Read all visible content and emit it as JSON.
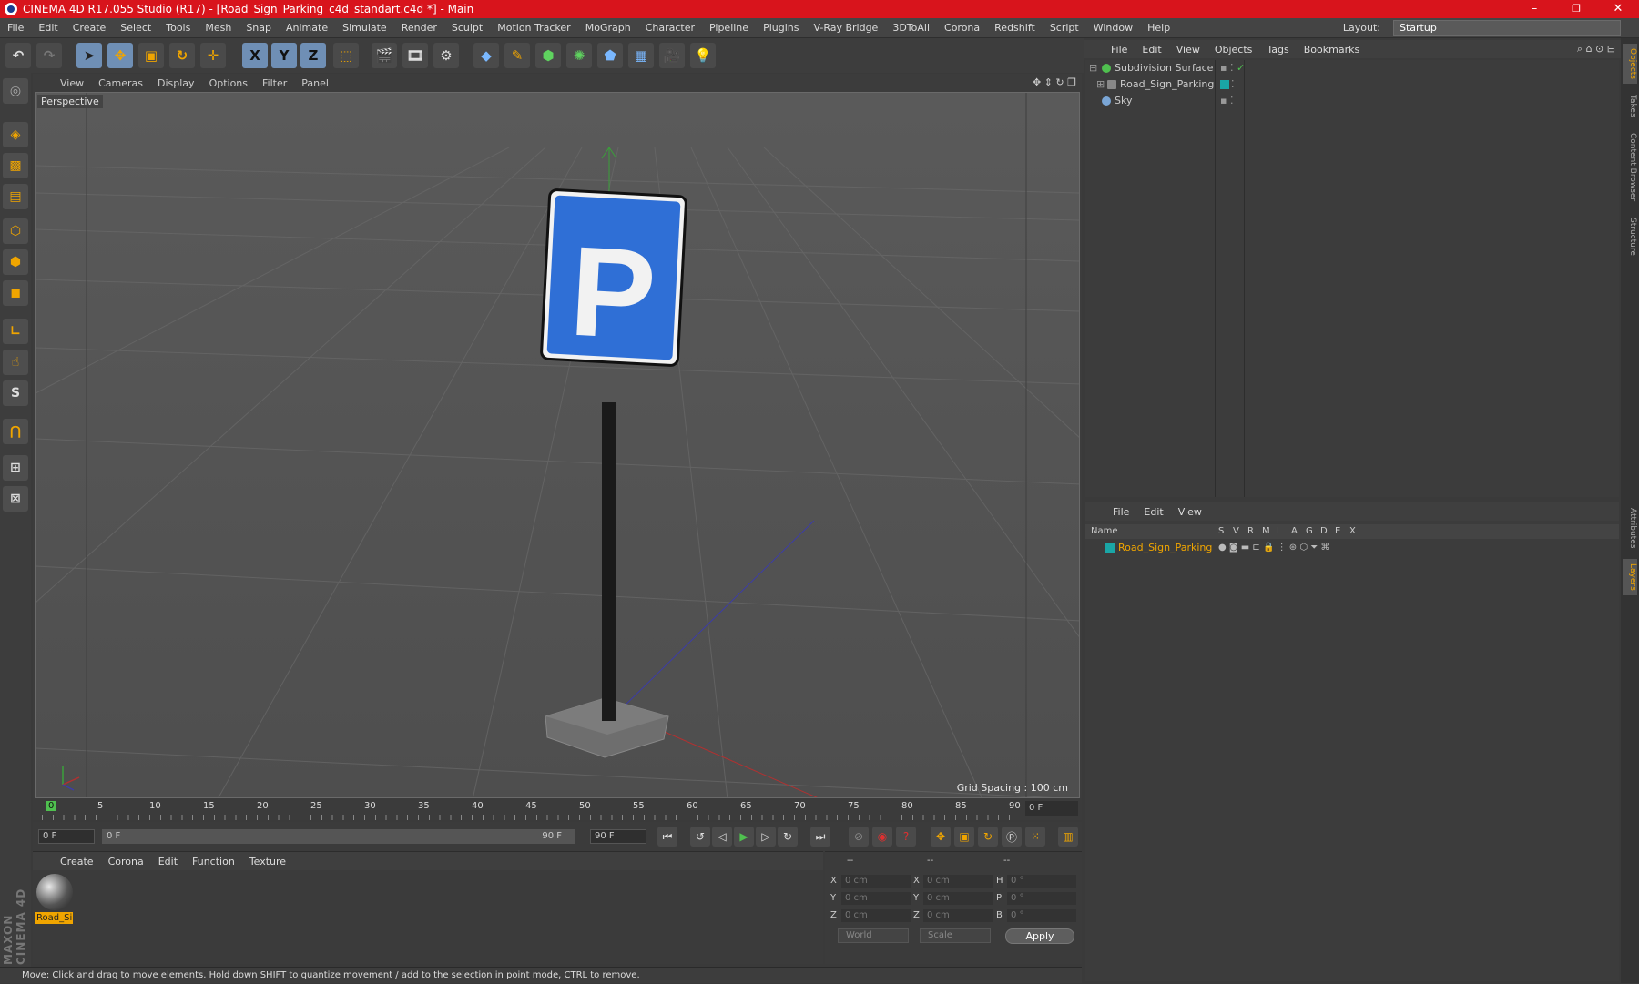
{
  "window": {
    "title": "CINEMA 4D R17.055 Studio (R17) - [Road_Sign_Parking_c4d_standart.c4d *] - Main",
    "minimize": "–",
    "restore": "❐",
    "close": "✕"
  },
  "menubar": {
    "items": [
      "File",
      "Edit",
      "Create",
      "Select",
      "Tools",
      "Mesh",
      "Snap",
      "Animate",
      "Simulate",
      "Render",
      "Sculpt",
      "Motion Tracker",
      "MoGraph",
      "Character",
      "Pipeline",
      "Plugins",
      "V-Ray Bridge",
      "3DToAll",
      "Corona",
      "Redshift",
      "Script",
      "Window",
      "Help"
    ],
    "layout_label": "Layout:",
    "layout_value": "Startup"
  },
  "toolbar": {
    "x": "X",
    "y": "Y",
    "z": "Z"
  },
  "viewport": {
    "menu": [
      "View",
      "Cameras",
      "Display",
      "Options",
      "Filter",
      "Panel"
    ],
    "label": "Perspective",
    "grid_spacing": "Grid Spacing : 100 cm",
    "sign_letter": "P"
  },
  "timeline": {
    "ticks": [
      "0",
      "5",
      "10",
      "15",
      "20",
      "25",
      "30",
      "35",
      "40",
      "45",
      "50",
      "55",
      "60",
      "65",
      "70",
      "75",
      "80",
      "85",
      "90"
    ],
    "frame_right": "0 F"
  },
  "transport": {
    "start": "0 F",
    "slider_left": "0 F",
    "slider_right": "90 F",
    "end": "90 F"
  },
  "materials": {
    "menu": [
      "Create",
      "Corona",
      "Edit",
      "Function",
      "Texture"
    ],
    "mat_name": "Road_Si"
  },
  "coords": {
    "headers": [
      "--",
      "--",
      "--"
    ],
    "x_label": "X",
    "y_label": "Y",
    "z_label": "Z",
    "h_label": "H",
    "p_label": "P",
    "b_label": "B",
    "pos_x": "0 cm",
    "pos_y": "0 cm",
    "pos_z": "0 cm",
    "size_x": "0 cm",
    "size_y": "0 cm",
    "size_z": "0 cm",
    "rot_h": "0 °",
    "rot_p": "0 °",
    "rot_b": "0 °",
    "mode1": "World",
    "mode2": "Scale",
    "apply": "Apply"
  },
  "objects": {
    "menu": [
      "File",
      "Edit",
      "View",
      "Objects",
      "Tags",
      "Bookmarks"
    ],
    "rows": [
      "Subdivision Surface",
      "Road_Sign_Parking",
      "Sky"
    ]
  },
  "layers": {
    "menu": [
      "File",
      "Edit",
      "View"
    ],
    "name_header": "Name",
    "flags": [
      "S",
      "V",
      "R",
      "M",
      "L",
      "A",
      "G",
      "D",
      "E",
      "X"
    ],
    "row": "Road_Sign_Parking"
  },
  "sidetabs": [
    "Objects",
    "Takes",
    "Content Browser",
    "Structure",
    "Attributes",
    "Layers"
  ],
  "status": "Move: Click and drag to move elements. Hold down SHIFT to quantize movement / add to the selection in point mode, CTRL to remove.",
  "brand": "MAXON CINEMA 4D"
}
